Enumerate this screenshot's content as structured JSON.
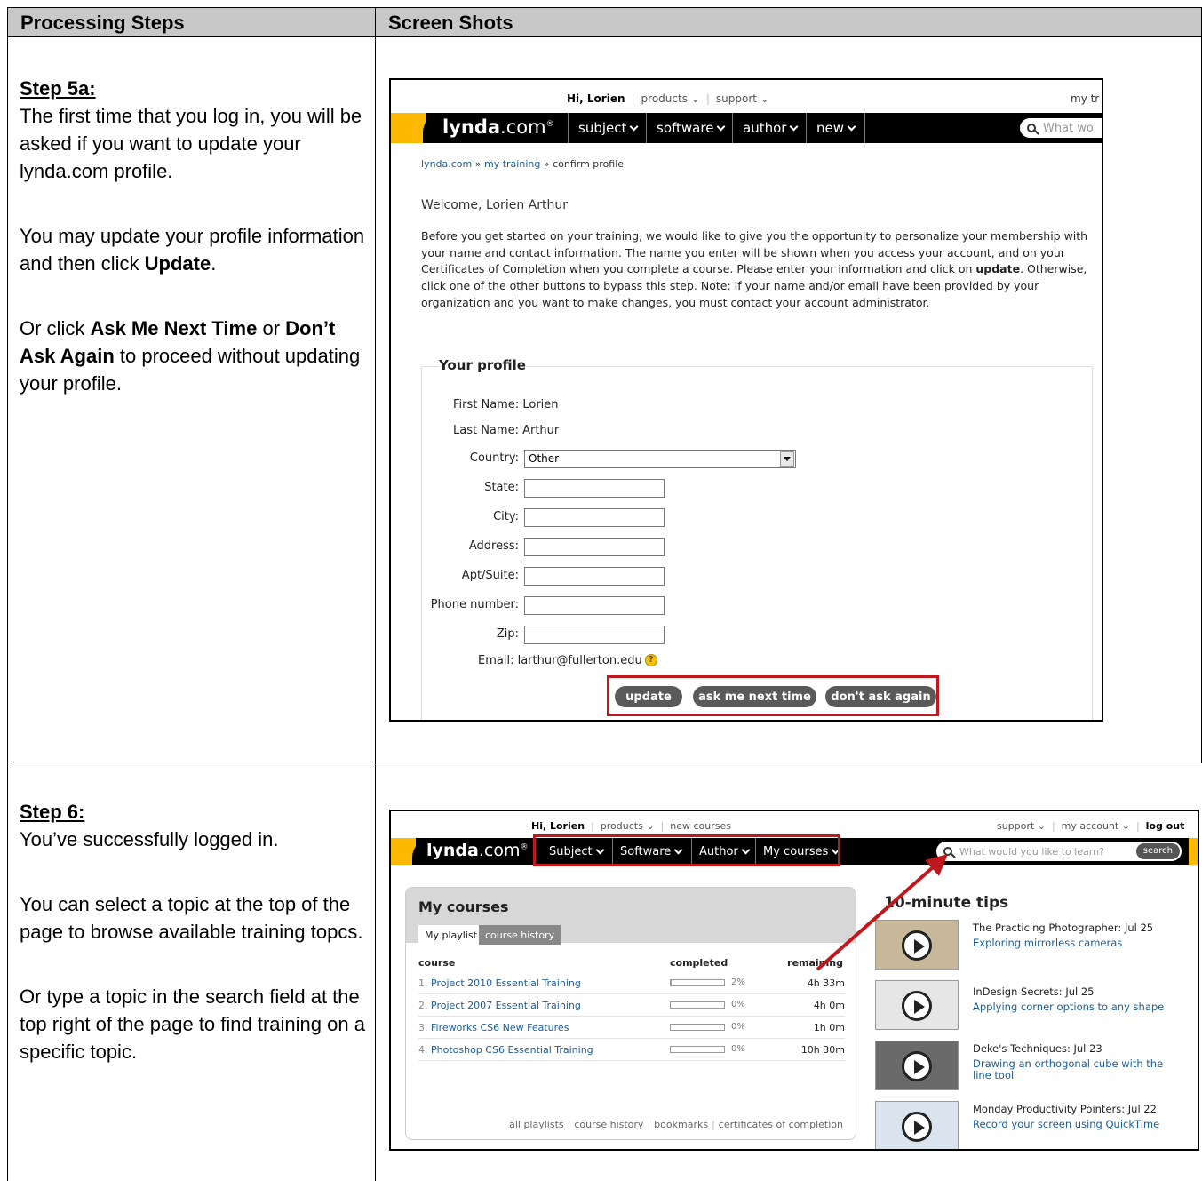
{
  "table": {
    "col1_header": "Processing Steps",
    "col2_header": "Screen Shots"
  },
  "step5a": {
    "title": "Step 5a:",
    "p1": "The first time that you log in, you will be asked if you want to update your lynda.com profile.",
    "p2_pre": "You may update your profile information and then click ",
    "p2_bold": "Update",
    "p2_post": ".",
    "p3_pre": "Or click ",
    "p3_bold1": "Ask Me Next Time",
    "p3_mid": " or ",
    "p3_bold2": "Don’t Ask Again",
    "p3_post": " to proceed without updating your profile."
  },
  "step6": {
    "title": "Step 6:",
    "p1": "You’ve successfully logged in.",
    "p2": "You can select a topic at the top of the page to browse available training topcs.",
    "p3": "Or type a topic in the search field at the top right of the page to find training on a specific topic."
  },
  "shot1": {
    "greeting": "Hi, Lorien",
    "products": "products",
    "support": "support",
    "my_training_partial": "my tr",
    "logo_bold": "lynda",
    "logo_rest": ".com",
    "nav": [
      "subject",
      "software",
      "author",
      "new"
    ],
    "search_placeholder": "What wo",
    "breadcrumb_1": "lynda.com",
    "breadcrumb_2": "my training",
    "breadcrumb_3": "confirm profile",
    "breadcrumb_sep": "»",
    "welcome": "Welcome, Lorien Arthur",
    "intro_pre": "Before you get started on your training, we would like to give you the opportunity to personalize your membership with your name and contact information. The name you enter will be shown when you access your account, and on your Certificates of Completion when you complete a course. Please enter your information and click on ",
    "intro_bold": "update",
    "intro_post": ". Otherwise, click one of the other buttons to bypass this step. Note: If your name and/or email have been provided by your organization and you want to make changes, you must contact your account administrator.",
    "legend": "Your profile",
    "first_name": "First Name: Lorien",
    "last_name": "Last Name: Arthur",
    "country_label": "Country:",
    "country_value": "Other",
    "state_label": "State:",
    "city_label": "City:",
    "address_label": "Address:",
    "apt_label": "Apt/Suite:",
    "phone_label": "Phone number:",
    "zip_label": "Zip:",
    "email": "Email: larthur@fullerton.edu",
    "help_glyph": "?",
    "btn_update": "update",
    "btn_next": "ask me next time",
    "btn_dont": "don't ask again"
  },
  "shot2": {
    "greeting": "Hi, Lorien",
    "products": "products",
    "new_courses": "new courses",
    "support": "support",
    "my_account": "my account",
    "log_out": "log out",
    "logo_bold": "lynda",
    "logo_rest": ".com",
    "nav": [
      "Subject",
      "Software",
      "Author",
      "My courses"
    ],
    "search_placeholder": "What would you like to learn?",
    "search_button": "search",
    "panel_title": "My courses",
    "tab_playlist": "My playlist",
    "tab_history": "course history",
    "col_course": "course",
    "col_completed": "completed",
    "col_remaining": "remaining",
    "courses": [
      {
        "num": "1.",
        "name": "Project 2010 Essential Training",
        "pct": "2%",
        "progress": 0.02,
        "remaining": "4h 33m"
      },
      {
        "num": "2.",
        "name": "Project 2007 Essential Training",
        "pct": "0%",
        "progress": 0,
        "remaining": "4h 0m"
      },
      {
        "num": "3.",
        "name": "Fireworks CS6 New Features",
        "pct": "0%",
        "progress": 0,
        "remaining": "1h 0m"
      },
      {
        "num": "4.",
        "name": "Photoshop CS6 Essential Training",
        "pct": "0%",
        "progress": 0,
        "remaining": "10h 30m"
      }
    ],
    "footer_links": [
      "all playlists",
      "course history",
      "bookmarks",
      "certificates of completion"
    ],
    "tips_title": "10-minute tips",
    "tips": [
      {
        "title": "The Practicing Photographer: Jul 25",
        "link": "Exploring mirrorless cameras"
      },
      {
        "title": "InDesign Secrets: Jul 25",
        "link": "Applying corner options to any shape"
      },
      {
        "title": "Deke's Techniques: Jul 23",
        "link": "Drawing an orthogonal cube with the line tool"
      },
      {
        "title": "Monday Productivity Pointers: Jul 22",
        "link": "Record your screen using QuickTime"
      }
    ]
  },
  "colors": {
    "header_bg": "#c8c8c8",
    "brand_yellow": "#fcb900",
    "highlight_red": "#c0181d",
    "link_blue": "#1a5c99"
  }
}
